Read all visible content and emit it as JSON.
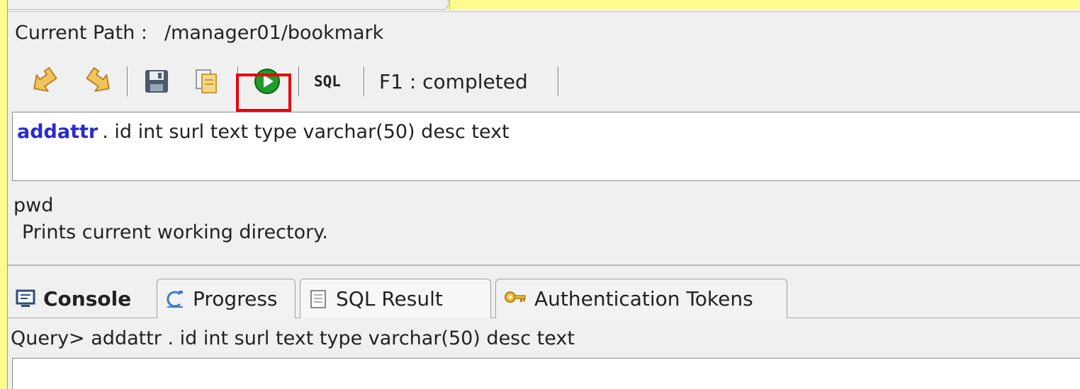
{
  "path": {
    "label": "Current Path :",
    "value": "/manager01/bookmark"
  },
  "toolbar": {
    "icons": [
      "back-arrow-icon",
      "forward-arrow-icon",
      "save-icon",
      "copy-icon",
      "run-icon"
    ],
    "sql_label": "SQL",
    "status": "F1 : completed"
  },
  "editor": {
    "keyword": "addattr",
    "rest": ". id int surl text type varchar(50) desc text"
  },
  "help": {
    "command": "pwd",
    "description": "Prints current working directory."
  },
  "tabs": [
    {
      "label": "Console",
      "icon": "console-icon"
    },
    {
      "label": "Progress",
      "icon": "progress-icon"
    },
    {
      "label": "SQL Result",
      "icon": "sql-result-icon"
    },
    {
      "label": "Authentication Tokens",
      "icon": "key-icon"
    }
  ],
  "query": {
    "text": "Query> addattr . id int surl text type varchar(50) desc text"
  },
  "colors": {
    "highlight": "#e8000c",
    "keyword": "#2a2ad4",
    "background": "#fffb8f",
    "run": "#1f9c2a"
  }
}
